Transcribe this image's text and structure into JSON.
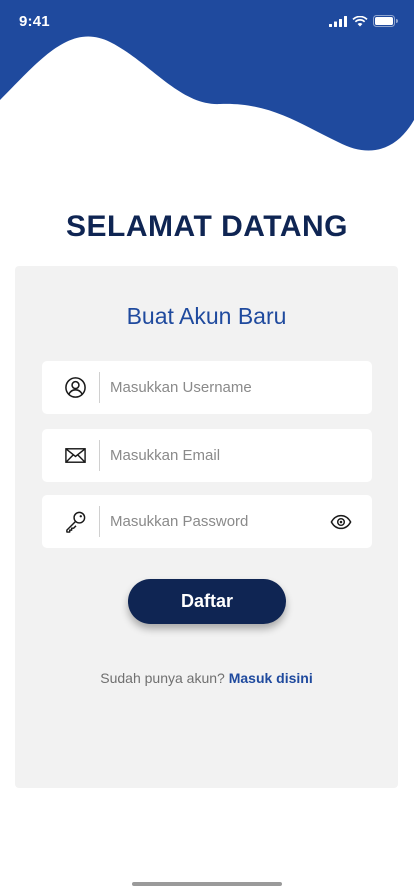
{
  "status": {
    "time": "9:41"
  },
  "heading": "SELAMAT DATANG",
  "card": {
    "title": "Buat Akun Baru",
    "username": {
      "placeholder": "Masukkan Username",
      "value": ""
    },
    "email": {
      "placeholder": "Masukkan Email",
      "value": ""
    },
    "password": {
      "placeholder": "Masukkan Password",
      "value": ""
    },
    "submit_label": "Daftar",
    "login_prompt": "Sudah punya akun?",
    "login_link": "Masuk disini"
  },
  "colors": {
    "primary": "#1f4a9e",
    "dark": "#0f2553",
    "card_bg": "#f2f2f2"
  },
  "icons": [
    "user-circle-icon",
    "envelope-icon",
    "key-icon",
    "eye-icon"
  ]
}
